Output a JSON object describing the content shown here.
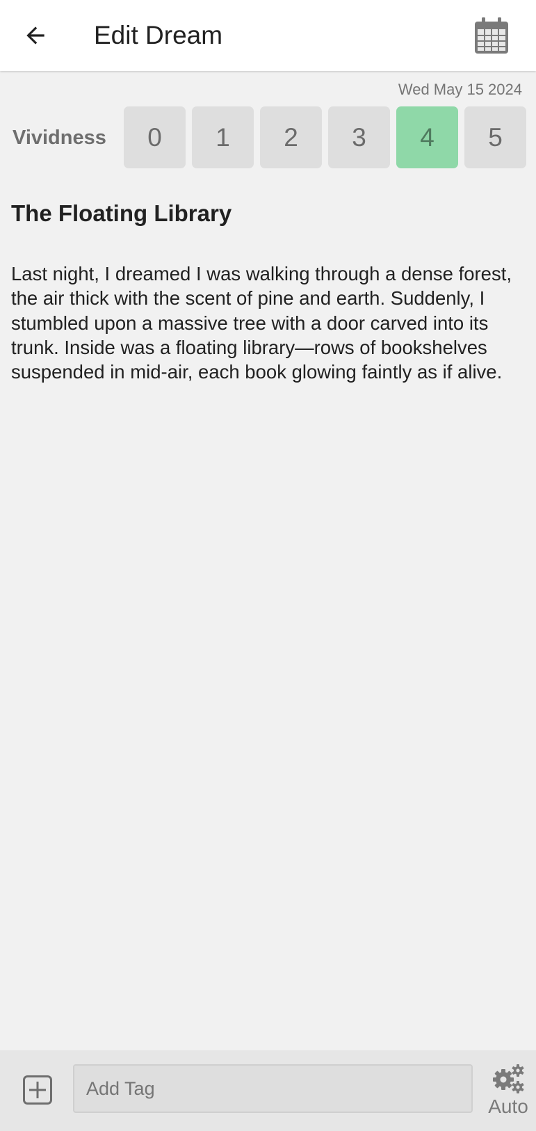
{
  "header": {
    "title": "Edit Dream",
    "back_icon": "arrow-left-icon",
    "calendar_icon": "calendar-icon"
  },
  "entry": {
    "date": "Wed May 15 2024",
    "vividness_label": "Vividness",
    "vividness_options": [
      "0",
      "1",
      "2",
      "3",
      "4",
      "5"
    ],
    "vividness_selected": "4",
    "title": "The Floating Library",
    "body": "Last night, I dreamed I was walking through a dense forest, the air thick with the scent of pine and earth. Suddenly, I stumbled upon a massive tree with a door carved into its trunk. Inside was a floating library—rows of bookshelves suspended in mid-air, each book glowing faintly as if alive."
  },
  "bottom_bar": {
    "add_icon": "plus-square-icon",
    "tag_input_value": "",
    "tag_input_placeholder": "Add Tag",
    "auto_icon": "gears-icon",
    "auto_label": "Auto"
  },
  "colors": {
    "selected_vividness": "#8fd8a8",
    "unselected_vividness": "#dedede",
    "background": "#f1f1f1",
    "app_bar": "#ffffff"
  }
}
